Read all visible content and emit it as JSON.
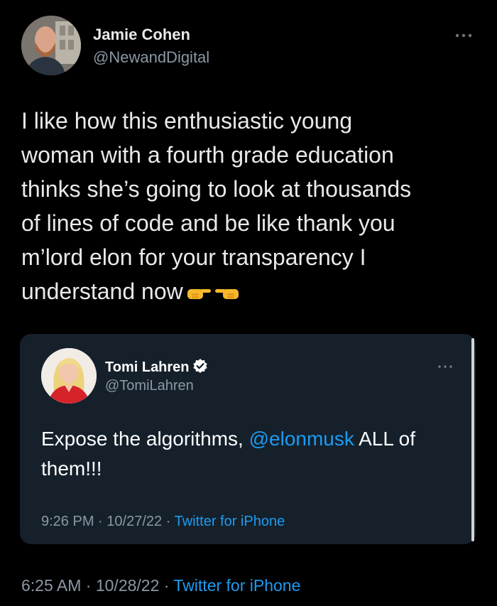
{
  "tweet": {
    "author": {
      "name": "Jamie Cohen",
      "handle": "@NewandDigital",
      "avatar_icon": "profile-photo-man-beard"
    },
    "more_icon": "more-options-ellipsis",
    "text_lines": [
      "I like how this enthusiastic young",
      "woman with a fourth grade education",
      "thinks she’s going to look at thousands",
      "of lines of code and be like thank you",
      "m’lord elon for your transparency I",
      "understand now"
    ],
    "emojis": [
      "backhand-index-pointing-right",
      "backhand-index-pointing-left"
    ],
    "time": "6:25 AM",
    "date": "10/28/22",
    "separator": "·",
    "source": "Twitter for iPhone"
  },
  "quoted_tweet": {
    "author": {
      "name": "Tomi Lahren",
      "handle": "@TomiLahren",
      "verified_icon": "verified-badge",
      "avatar_icon": "profile-photo-woman-blonde"
    },
    "text_before": "Expose the algorithms, ",
    "mention": "@elonmusk",
    "text_after": " ALL of them!!!",
    "time": "9:26 PM",
    "date": "10/27/22",
    "separator": "·",
    "source": "Twitter for iPhone"
  },
  "colors": {
    "background": "#000000",
    "card_background": "#15202b",
    "primary_text": "#e7e9ea",
    "secondary_text": "#8b98a5",
    "accent": "#1d9bf0"
  }
}
